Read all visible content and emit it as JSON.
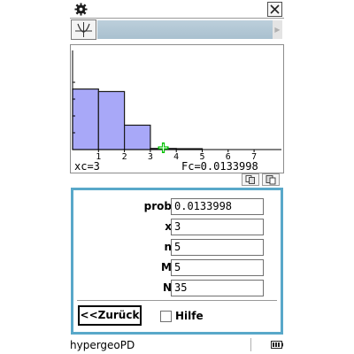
{
  "window": {
    "title_icon": "gear-icon",
    "close_icon": "close-icon"
  },
  "toolbar": {
    "graph_icon": "graph-icon",
    "scroll_icon": "right-arrow-icon"
  },
  "graph": {
    "x_ticks": [
      "1",
      "2",
      "3",
      "4",
      "5",
      "6",
      "7"
    ],
    "xc_label": "xc=3",
    "fc_label": "Fc=0.0133998",
    "bar_color": "#a8a8f8",
    "cursor_color": "#00c000"
  },
  "chart_data": {
    "type": "bar",
    "x": [
      0,
      1,
      2,
      3,
      4,
      5,
      6,
      7
    ],
    "values": [
      0.72,
      0.69,
      0.29,
      0.0134,
      0.006,
      0.0,
      0.0,
      0.0
    ],
    "xlim": [
      0,
      8
    ],
    "ylim": [
      0,
      1
    ],
    "cursor_x": 3
  },
  "copy_buttons": [
    "copy-icon",
    "paste-icon"
  ],
  "form": {
    "fields": [
      {
        "label": "prob",
        "value": "0.0133998"
      },
      {
        "label": "x",
        "value": "3"
      },
      {
        "label": "n",
        "value": "5"
      },
      {
        "label": "M",
        "value": "5"
      },
      {
        "label": "N",
        "value": "35"
      }
    ],
    "back_label": "<<Zurück",
    "help_label": "Hilfe",
    "help_checked": false
  },
  "status": {
    "app_name": "hypergeoPD",
    "battery_icon": "battery-icon"
  },
  "colors": {
    "panel_border": "#59a8c9"
  }
}
